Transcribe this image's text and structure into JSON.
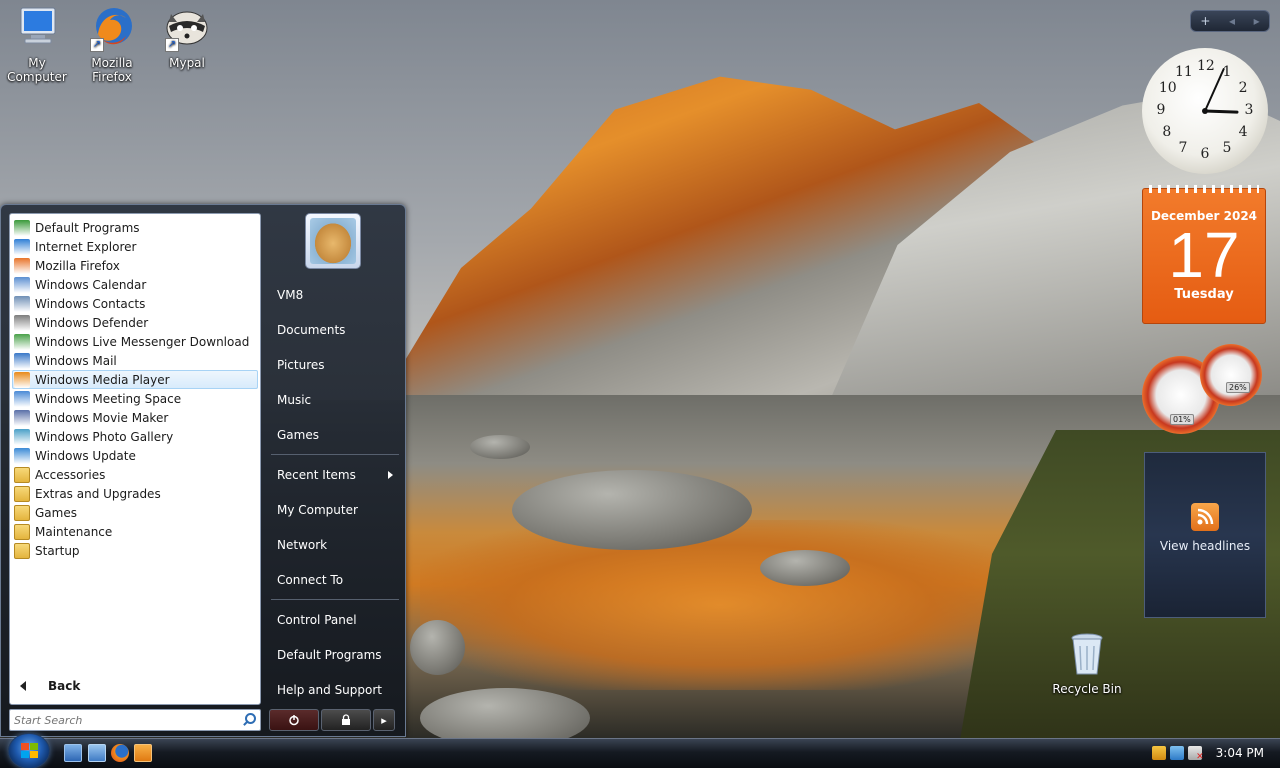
{
  "desktop": {
    "icons": [
      {
        "label": "My Computer",
        "icon": "computer-icon"
      },
      {
        "label": "Mozilla Firefox",
        "icon": "firefox-icon"
      },
      {
        "label": "Mypal",
        "icon": "mypal-icon"
      },
      {
        "label": "Recycle Bin",
        "icon": "recycle-bin-icon"
      }
    ]
  },
  "gadgets": {
    "clock": {
      "numbers": [
        "12",
        "1",
        "2",
        "3",
        "4",
        "5",
        "6",
        "7",
        "8",
        "9",
        "10",
        "11"
      ],
      "time": "3:04"
    },
    "calendar": {
      "month": "December 2024",
      "day": "17",
      "weekday": "Tuesday"
    },
    "cpu_meter": {
      "cpu": "01%",
      "memory": "26%"
    },
    "feed": {
      "label": "View headlines"
    }
  },
  "start_menu": {
    "programs": [
      {
        "label": "Default Programs",
        "icon": "default-programs-icon",
        "color": "#3a9a3a"
      },
      {
        "label": "Internet Explorer",
        "icon": "internet-explorer-icon",
        "color": "#2f7fd6"
      },
      {
        "label": "Mozilla Firefox",
        "icon": "firefox-icon",
        "color": "#e8742a"
      },
      {
        "label": "Windows Calendar",
        "icon": "calendar-icon",
        "color": "#5b8fd1"
      },
      {
        "label": "Windows Contacts",
        "icon": "contacts-icon",
        "color": "#6e8fb5"
      },
      {
        "label": "Windows Defender",
        "icon": "defender-icon",
        "color": "#7d7d7d"
      },
      {
        "label": "Windows Live Messenger Download",
        "icon": "messenger-icon",
        "color": "#4aa14a"
      },
      {
        "label": "Windows Mail",
        "icon": "mail-icon",
        "color": "#3a78c8"
      },
      {
        "label": "Windows Media Player",
        "icon": "media-player-icon",
        "color": "#e88a1a"
      },
      {
        "label": "Windows Meeting Space",
        "icon": "meeting-space-icon",
        "color": "#4a8ad6"
      },
      {
        "label": "Windows Movie Maker",
        "icon": "movie-maker-icon",
        "color": "#5a6fa8"
      },
      {
        "label": "Windows Photo Gallery",
        "icon": "photo-gallery-icon",
        "color": "#4aa0c8"
      },
      {
        "label": "Windows Update",
        "icon": "update-icon",
        "color": "#3a8ad6"
      },
      {
        "label": "Accessories",
        "icon": "folder-icon",
        "color": "#e4b43e"
      },
      {
        "label": "Extras and Upgrades",
        "icon": "folder-icon",
        "color": "#e4b43e"
      },
      {
        "label": "Games",
        "icon": "folder-icon",
        "color": "#e4b43e"
      },
      {
        "label": "Maintenance",
        "icon": "folder-icon",
        "color": "#e4b43e"
      },
      {
        "label": "Startup",
        "icon": "folder-icon",
        "color": "#e4b43e"
      }
    ],
    "hovered_program": "Windows Media Player",
    "back_label": "Back",
    "search_placeholder": "Start Search",
    "right_items": [
      {
        "label": "VM8"
      },
      {
        "label": "Documents"
      },
      {
        "label": "Pictures"
      },
      {
        "label": "Music"
      },
      {
        "label": "Games"
      },
      {
        "label": "Recent Items",
        "submenu": true
      },
      {
        "label": "My Computer"
      },
      {
        "label": "Network"
      },
      {
        "label": "Connect To"
      },
      {
        "label": "Control Panel"
      },
      {
        "label": "Default Programs"
      },
      {
        "label": "Help and Support"
      }
    ]
  },
  "taskbar": {
    "quick_launch": [
      "show-desktop-icon",
      "switch-windows-icon",
      "firefox-icon",
      "media-player-icon"
    ],
    "tray_icons": [
      "security-icon",
      "network-icon",
      "volume-muted-icon"
    ],
    "time": "3:04 PM"
  },
  "colors": {
    "accent": "#1f5bb0",
    "calendar_orange": "#e55c12",
    "hover_blue": "#d8ebfb"
  }
}
